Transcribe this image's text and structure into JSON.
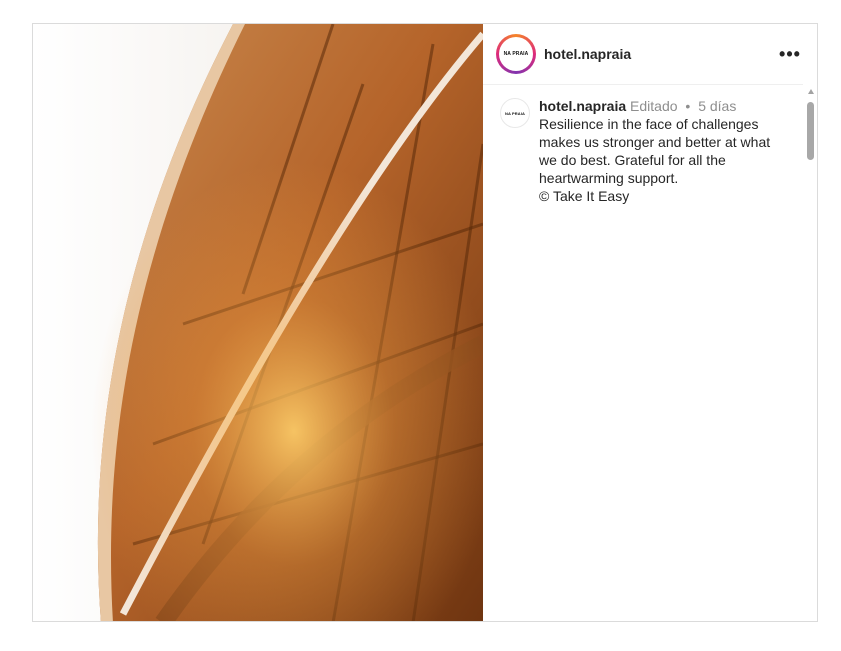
{
  "post": {
    "image": {
      "description_icon": "image-placeholder",
      "colors": {
        "wood_light": "#d9944a",
        "wood_dark": "#7a3d12",
        "sky": "#f7f4f0"
      }
    },
    "header": {
      "avatar_text": "NA PRAIA",
      "username": "hotel.napraia",
      "more_icon": "ellipsis-icon",
      "more_label": "•••"
    },
    "comment": {
      "avatar_text": "NA PRAIA",
      "username": "hotel.napraia",
      "edited": "Editado",
      "separator": "•",
      "time": "5 días",
      "caption_lines": [
        "Resilience in the face of challenges",
        "makes us stronger and better at what",
        "we do best. Grateful for all the",
        "heartwarming support.",
        "© Take It Easy"
      ]
    },
    "scrollbar": {
      "up_icon": "scroll-up-arrow-icon"
    },
    "theme": {
      "text": "#262626",
      "muted": "#8e8e8e",
      "border": "#dbdbdb"
    }
  }
}
